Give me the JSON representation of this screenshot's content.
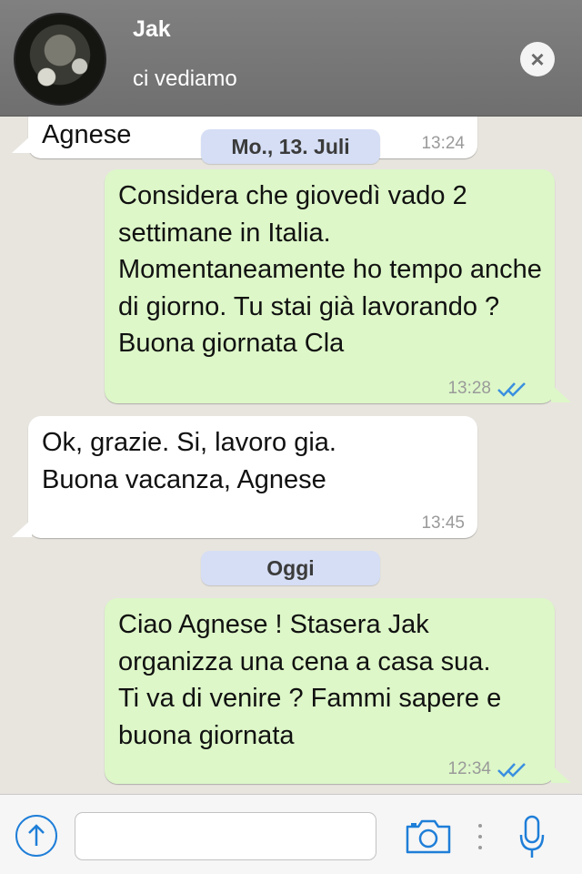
{
  "header": {
    "contact_name": "Jak",
    "status": "ci vediamo",
    "close_label": "×"
  },
  "messages": [
    {
      "id": "m0",
      "direction": "in",
      "text": "Agnese",
      "time": "13:24"
    },
    {
      "id": "m1",
      "direction": "out",
      "text": "Considera che giovedì vado 2 settimane in Italia. Momentaneamente ho tempo anche di giorno. Tu stai già lavorando ? Buona giornata Cla",
      "time": "13:28",
      "read": true
    },
    {
      "id": "m2",
      "direction": "in",
      "text": "Ok, grazie. Si, lavoro gia. Buona vacanza, Agnese",
      "time": "13:45"
    },
    {
      "id": "m3",
      "direction": "out",
      "text": "Ciao Agnese ! Stasera Jak organizza una cena a casa sua. Ti va di venire ? Fammi sapere e buona giornata",
      "time": "12:34",
      "read": true
    }
  ],
  "date_separators": {
    "first": "Mo., 13. Juli",
    "second": "Oggi"
  },
  "input": {
    "value": "",
    "placeholder": ""
  },
  "colors": {
    "accent": "#1e7ed8",
    "outgoing_bubble": "#ddf7c8",
    "incoming_bubble": "#ffffff",
    "read_ticks": "#3a8fe0",
    "date_pill": "#d5def4"
  },
  "icons": {
    "share": "arrow-up-circle-icon",
    "camera": "camera-icon",
    "mic": "microphone-icon",
    "close": "close-icon",
    "read": "double-check-icon"
  }
}
